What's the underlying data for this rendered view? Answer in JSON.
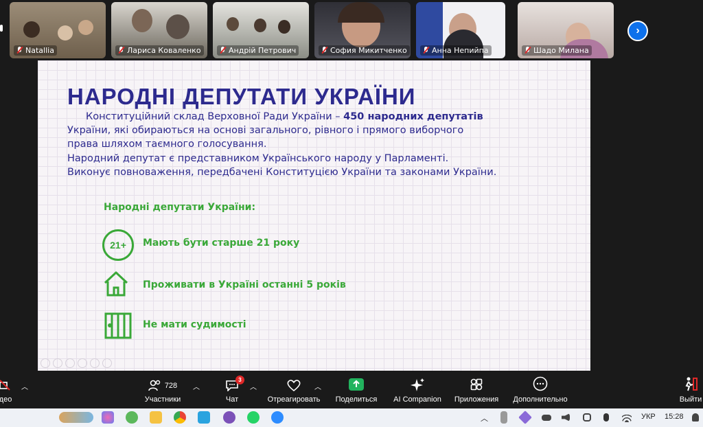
{
  "participants": [
    {
      "name": "Natallia",
      "bg": "#8a7a66"
    },
    {
      "name": "Лариса Коваленко",
      "bg": "#6e6a5e"
    },
    {
      "name": "Андрій Петрович",
      "bg": "#8b8d85"
    },
    {
      "name": "София Микитченко",
      "bg": "#4a4a52"
    },
    {
      "name": "Анна Непийпа",
      "bg": "#3b4e8c"
    },
    {
      "name": "Шадо Милана",
      "bg": "#b8a9a4"
    }
  ],
  "slide": {
    "title": "НАРОДНІ ДЕПУТАТИ УКРАЇНИ",
    "line1_a": "Конституційний склад Верховної Ради України – ",
    "line1_b": "450 народних депутатів",
    "line2": "України, які обираються на основі загального, рівного і прямого виборчого",
    "line3": "права шляхом таємного голосування.",
    "line4": "Народний депутат є представником Українського народу у Парламенті.",
    "line5": "Виконує повноваження, передбачені Конституцією України та законами України.",
    "subheading": "Народні депутати України:",
    "icon_21_text": "21+",
    "requirements": [
      {
        "text": "Мають бути старше 21 року",
        "icon": "age-21-icon"
      },
      {
        "text": "Проживати в Україні останні 5 років",
        "icon": "house-icon"
      },
      {
        "text": "Не мати судимості",
        "icon": "prison-bars-icon"
      }
    ],
    "colors": {
      "title": "#2d2a8e",
      "green": "#3aa838"
    }
  },
  "toolbar": {
    "video_label": "део",
    "participants_count": "728",
    "participants_label": "Участники",
    "chat_badge": "3",
    "chat_label": "Чат",
    "react_label": "Отреагировать",
    "share_label": "Поделиться",
    "ai_label": "AI Companion",
    "apps_label": "Приложения",
    "more_label": "Дополнительно",
    "leave_label": "Выйти"
  },
  "taskbar": {
    "lang": "УКР",
    "time": "15:28"
  }
}
